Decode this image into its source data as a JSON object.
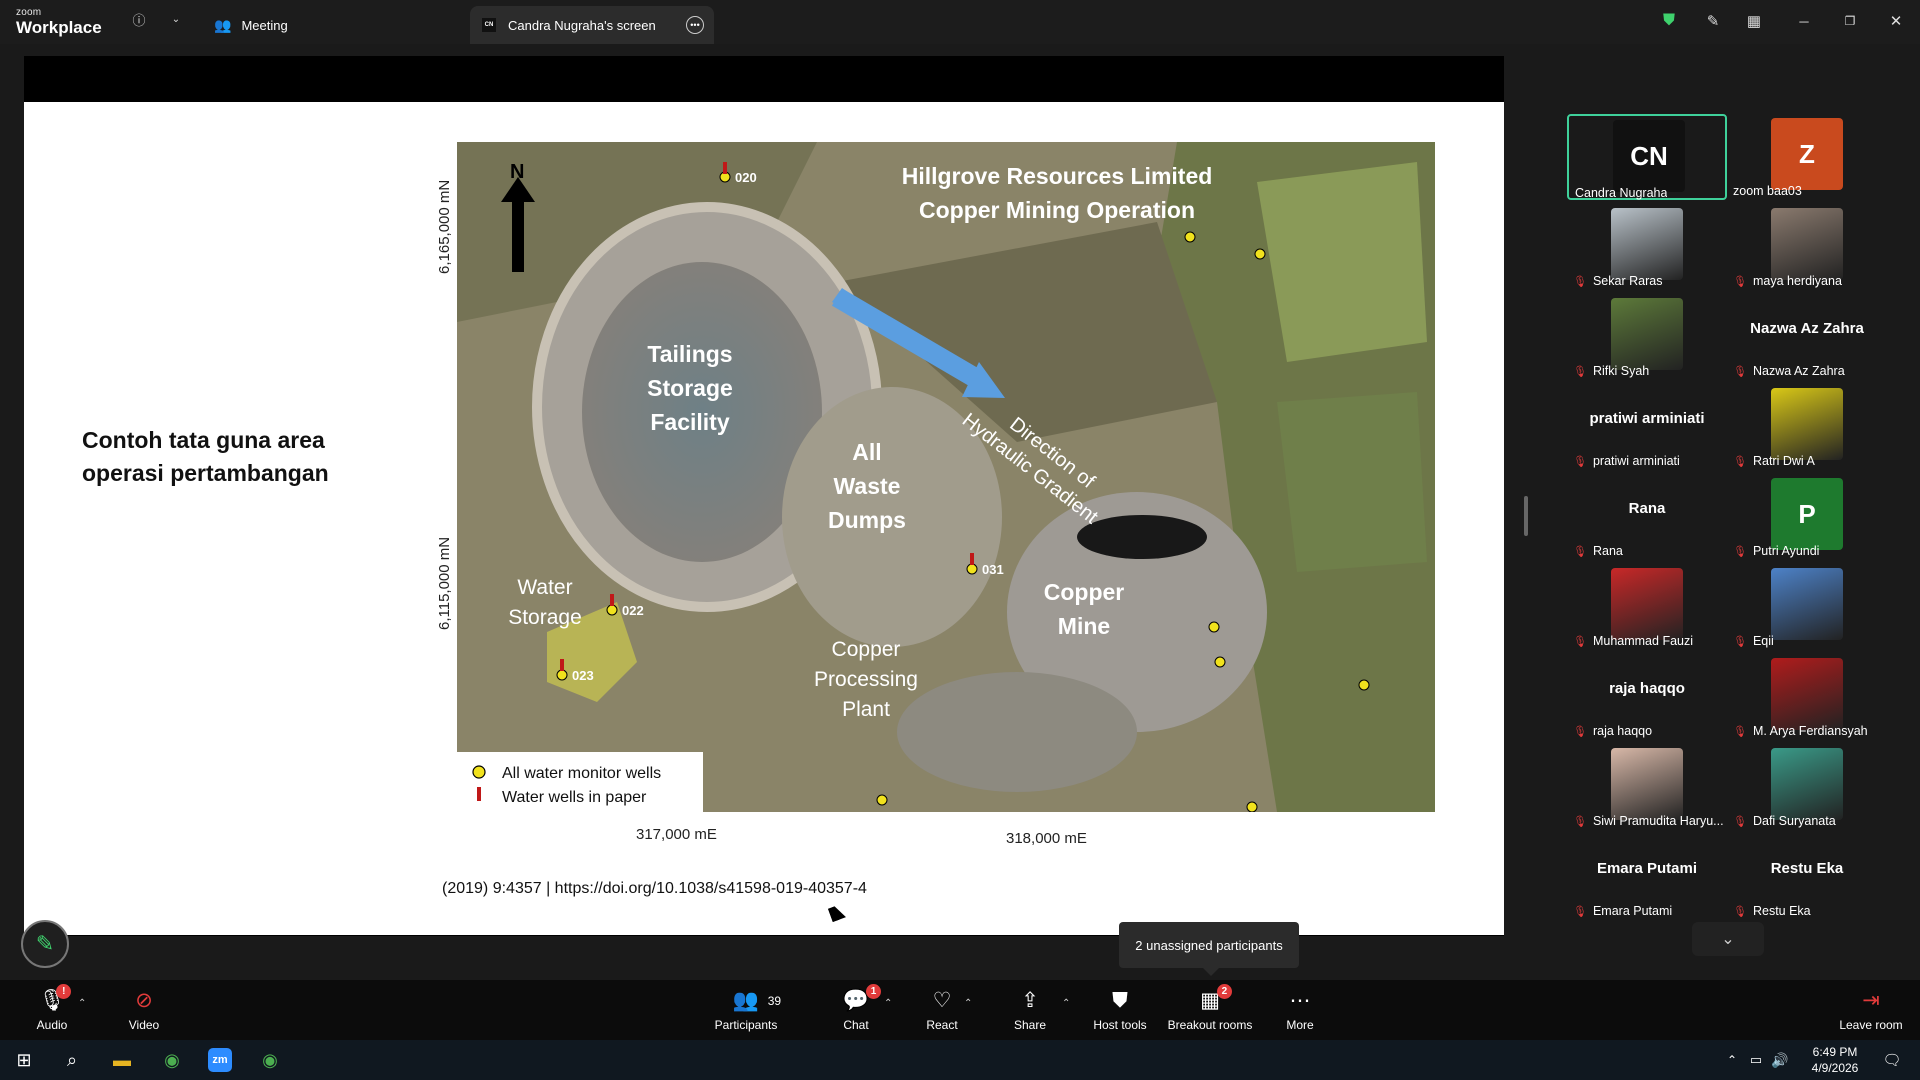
{
  "app": {
    "brand_top": "zoom",
    "brand_bottom": "Workplace"
  },
  "tabs": {
    "meeting": "Meeting",
    "screen": "Candra Nugraha's screen",
    "screen_avatar": "CN"
  },
  "slide": {
    "title": "Contoh tata guna area operasi pertambangan",
    "map": {
      "north": "N",
      "company_line1": "Hillgrove Resources Limited",
      "company_line2": "Copper Mining Operation",
      "tailings": [
        "Tailings",
        "Storage",
        "Facility"
      ],
      "waste": [
        "All",
        "Waste",
        "Dumps"
      ],
      "copper_mine": [
        "Copper",
        "Mine"
      ],
      "processing": [
        "Copper",
        "Processing",
        "Plant"
      ],
      "water": [
        "Water",
        "Storage"
      ],
      "direction": [
        "Direction of",
        "Hydraulic Gradient"
      ],
      "wells": [
        "020",
        "022",
        "023",
        "031"
      ],
      "legend_all": "All water monitor wells",
      "legend_paper": "Water wells in paper",
      "y_top": "6,165,000 mN",
      "y_bottom": "6,115,000 mN",
      "x_left": "317,000 mE",
      "x_right": "318,000 mE"
    },
    "citation": "(2019) 9:4357 | https://doi.org/10.1038/s41598-019-40357-4"
  },
  "participants": [
    {
      "name": "Candra Nugraha",
      "initials": "CN",
      "avatar_color": "#111111",
      "active": true,
      "muted": false
    },
    {
      "name": "zoom baa03",
      "initials": "Z",
      "avatar_color": "#c94a1e",
      "muted": false
    },
    {
      "name": "Sekar Raras",
      "photo": "#b9c2c9",
      "muted": true
    },
    {
      "name": "maya herdiyana",
      "photo": "#8a7a6e",
      "muted": true
    },
    {
      "name": "Rifki Syah",
      "photo": "#5d7a3a",
      "muted": true
    },
    {
      "name": "Nazwa Az Zahra",
      "big": "Nazwa Az Zahra",
      "muted": true
    },
    {
      "name": "pratiwi arminiati",
      "big": "pratiwi arminiati",
      "muted": true
    },
    {
      "name": "Ratri Dwi A",
      "photo": "#d9c817",
      "muted": true
    },
    {
      "name": "Rana",
      "big": "Rana",
      "muted": true
    },
    {
      "name": "Putri Ayundi",
      "initials": "P",
      "avatar_color": "#1e7a2e",
      "muted": true
    },
    {
      "name": "Muhammad Fauzi",
      "photo": "#c82828",
      "muted": true
    },
    {
      "name": "Eqii",
      "photo": "#4d82c8",
      "muted": true
    },
    {
      "name": "raja haqqo",
      "big": "raja haqqo",
      "muted": true
    },
    {
      "name": "M. Arya Ferdiansyah",
      "photo": "#b01c1c",
      "muted": true
    },
    {
      "name": "Siwi Pramudita Haryu...",
      "photo": "#d8b8a8",
      "muted": true
    },
    {
      "name": "Dafi Suryanata",
      "photo": "#3a9a88",
      "muted": true
    },
    {
      "name": "Emara Putami",
      "big": "Emara Putami",
      "muted": true
    },
    {
      "name": "Restu Eka",
      "big": "Restu Eka",
      "muted": true
    }
  ],
  "tooltip": "2 unassigned participants",
  "toolbar": {
    "audio": "Audio",
    "audio_badge": "!",
    "video": "Video",
    "participants": "Participants",
    "participants_count": "39",
    "chat": "Chat",
    "chat_badge": "1",
    "react": "React",
    "share": "Share",
    "host_tools": "Host tools",
    "breakout": "Breakout rooms",
    "breakout_badge": "2",
    "more": "More",
    "leave": "Leave room"
  },
  "taskbar": {
    "time": "6:49 PM",
    "date": "4/9/2026"
  },
  "colors": {
    "accent_green": "#3fd19b",
    "mute_red": "#e23b3b",
    "badge_red": "#e23b3b"
  }
}
